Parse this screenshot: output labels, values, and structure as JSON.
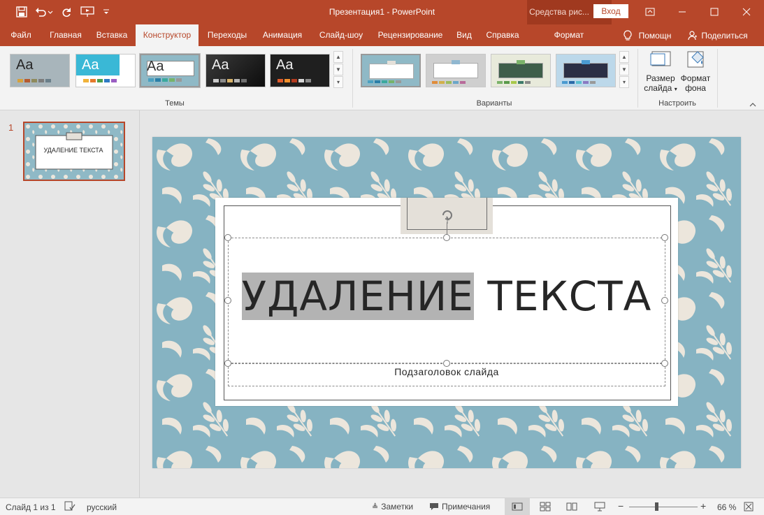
{
  "window": {
    "title": "Презентация1 - PowerPoint",
    "context_group": "Средства рис...",
    "signin": "Вход"
  },
  "tabs": [
    {
      "label": "Файл"
    },
    {
      "label": "Главная"
    },
    {
      "label": "Вставка"
    },
    {
      "label": "Конструктор"
    },
    {
      "label": "Переходы"
    },
    {
      "label": "Анимация"
    },
    {
      "label": "Слайд-шоу"
    },
    {
      "label": "Рецензирование"
    },
    {
      "label": "Вид"
    },
    {
      "label": "Справка"
    },
    {
      "label": "Формат"
    },
    {
      "label": "Помощн"
    },
    {
      "label": "Поделиться"
    }
  ],
  "ribbon": {
    "themes_label": "Темы",
    "variants_label": "Варианты",
    "customize_label": "Настроить",
    "theme_sample": "Aa",
    "slide_size_line1": "Размер",
    "slide_size_line2": "слайда",
    "format_bg_line1": "Формат",
    "format_bg_line2": "фона"
  },
  "colors": {
    "accent": "#b7472a",
    "slide_bg": "#86b3c2",
    "pattern": "#ece6dc"
  },
  "thumbnail": {
    "number": "1",
    "title": "УДАЛЕНИЕ ТЕКСТА"
  },
  "slide": {
    "title_selected": "УДАЛЕНИЕ",
    "title_rest": " ТЕКСТА",
    "subtitle": "Подзаголовок слайда"
  },
  "status": {
    "slide_count": "Слайд 1 из 1",
    "language": "русский",
    "notes": "Заметки",
    "comments": "Примечания",
    "zoom": "66 %",
    "zoom_fraction": 0.4
  }
}
